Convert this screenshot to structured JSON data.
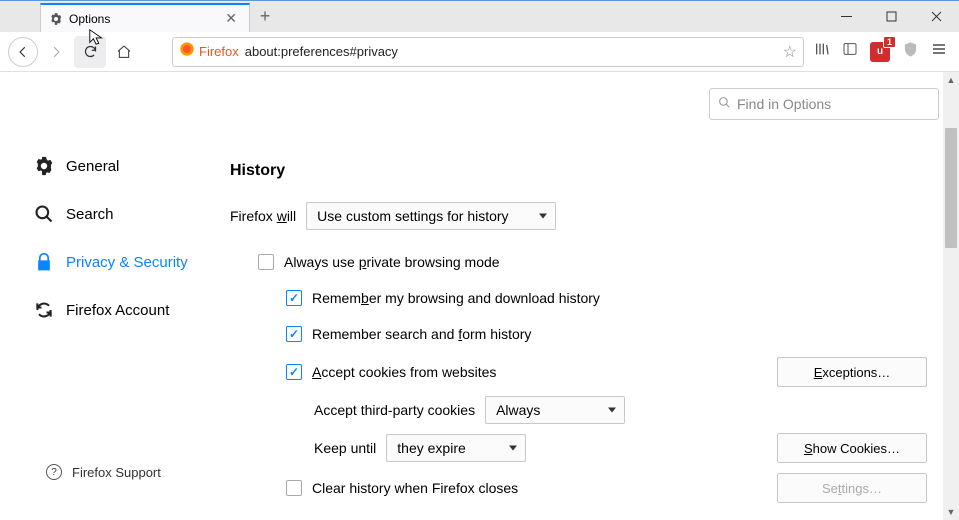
{
  "tab": {
    "title": "Options"
  },
  "urlbar": {
    "brand": "Firefox",
    "address": "about:preferences#privacy"
  },
  "ublock_badge": "1",
  "search": {
    "placeholder": "Find in Options"
  },
  "sidebar": {
    "general": "General",
    "search": "Search",
    "privacy": "Privacy & Security",
    "account": "Firefox Account",
    "support": "Firefox Support"
  },
  "history": {
    "heading": "History",
    "firefox_will_pre": "Firefox ",
    "firefox_will_u": "w",
    "firefox_will_post": "ill",
    "mode": "Use custom settings for history",
    "always_private_pre": "Always use ",
    "always_private_u": "p",
    "always_private_post": "rivate browsing mode",
    "remember_browsing_pre": "Remem",
    "remember_browsing_u": "b",
    "remember_browsing_post": "er my browsing and download history",
    "remember_search_pre": "Remember search and ",
    "remember_search_u": "f",
    "remember_search_post": "orm history",
    "accept_cookies_u": "A",
    "accept_cookies_post": "ccept cookies from websites",
    "exceptions_u": "E",
    "exceptions_post": "xceptions…",
    "third_party_label": "Accept third-party cookies",
    "third_party_value": "Always",
    "keep_until_label": "Keep until",
    "keep_until_value": "they expire",
    "show_cookies_u": "S",
    "show_cookies_post": "how Cookies…",
    "clear_close": "Clear history when Firefox closes",
    "settings_pre": "Se",
    "settings_u": "t",
    "settings_post": "tings…"
  }
}
